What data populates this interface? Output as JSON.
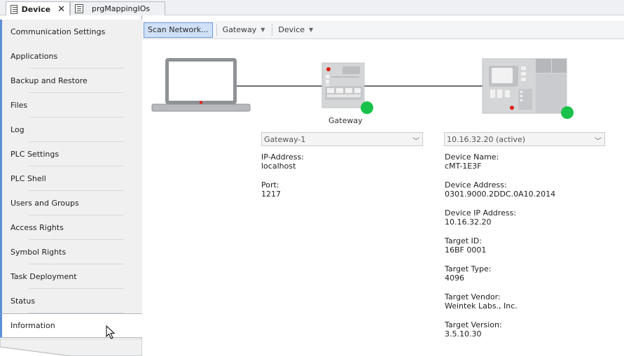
{
  "tabs": [
    {
      "label": "Device",
      "active": true,
      "close": "✕"
    },
    {
      "label": "prgMappingIOs",
      "active": false
    }
  ],
  "sidebar": {
    "items": [
      {
        "label": "Communication Settings"
      },
      {
        "label": "Applications"
      },
      {
        "label": "Backup and Restore"
      },
      {
        "label": "Files"
      },
      {
        "label": "Log"
      },
      {
        "label": "PLC Settings"
      },
      {
        "label": "PLC Shell"
      },
      {
        "label": "Users and Groups"
      },
      {
        "label": "Access Rights"
      },
      {
        "label": "Symbol Rights"
      },
      {
        "label": "Task Deployment"
      },
      {
        "label": "Status"
      },
      {
        "label": "Information"
      }
    ],
    "selected": "Information"
  },
  "toolbar": {
    "scan_label": "Scan Network...",
    "gateway_label": "Gateway",
    "device_label": "Device"
  },
  "gateway": {
    "caption": "Gateway",
    "dropdown_value": "Gateway-1",
    "ip_label": "IP-Address:",
    "ip_value": "localhost",
    "port_label": "Port:",
    "port_value": "1217",
    "status_color": "#18c24a"
  },
  "device": {
    "dropdown_value": "10.16.32.20 (active)",
    "fields": [
      {
        "label": "Device Name:",
        "value": "cMT-1E3F"
      },
      {
        "label": "Device Address:",
        "value": "0301.9000.2DDC.0A10.2014"
      },
      {
        "label": "Device IP Address:",
        "value": "10.16.32.20"
      },
      {
        "label": "Target ID:",
        "value": "16BF 0001"
      },
      {
        "label": "Target Type:",
        "value": "4096"
      },
      {
        "label": "Target Vendor:",
        "value": "Weintek Labs., Inc."
      },
      {
        "label": "Target Version:",
        "value": "3.5.10.30"
      }
    ],
    "status_color": "#18c24a"
  },
  "colors": {
    "accent": "#5b8fd6",
    "scan_bg": "#cfe0f7"
  }
}
